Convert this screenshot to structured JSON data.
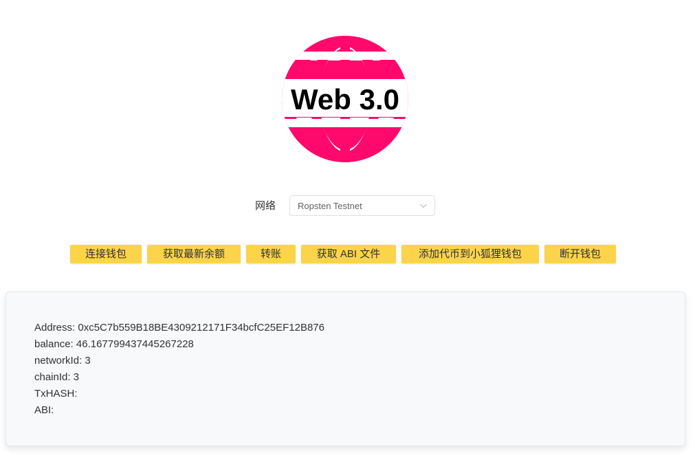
{
  "logo": {
    "text": "Web 3.0",
    "color": "#ff0a6c",
    "icon": "globe-icon"
  },
  "network": {
    "label": "网络",
    "selected": "Ropsten Testnet"
  },
  "buttons": [
    {
      "label": "连接钱包"
    },
    {
      "label": "获取最新余额"
    },
    {
      "label": "转账"
    },
    {
      "label": "获取 ABI 文件"
    },
    {
      "label": "添加代币到小狐狸钱包"
    },
    {
      "label": "断开钱包"
    }
  ],
  "info": {
    "address": "Address: 0xc5C7b559B18BE4309212171F34bcfC25EF12B876",
    "balance": "balance: 46.167799437445267228",
    "networkId": "networkId: 3",
    "chainId": "chainId: 3",
    "txhash": "TxHASH:",
    "abi": "ABI:"
  },
  "colors": {
    "accent_button": "#fbd449",
    "logo_pink": "#ff0a6c"
  }
}
